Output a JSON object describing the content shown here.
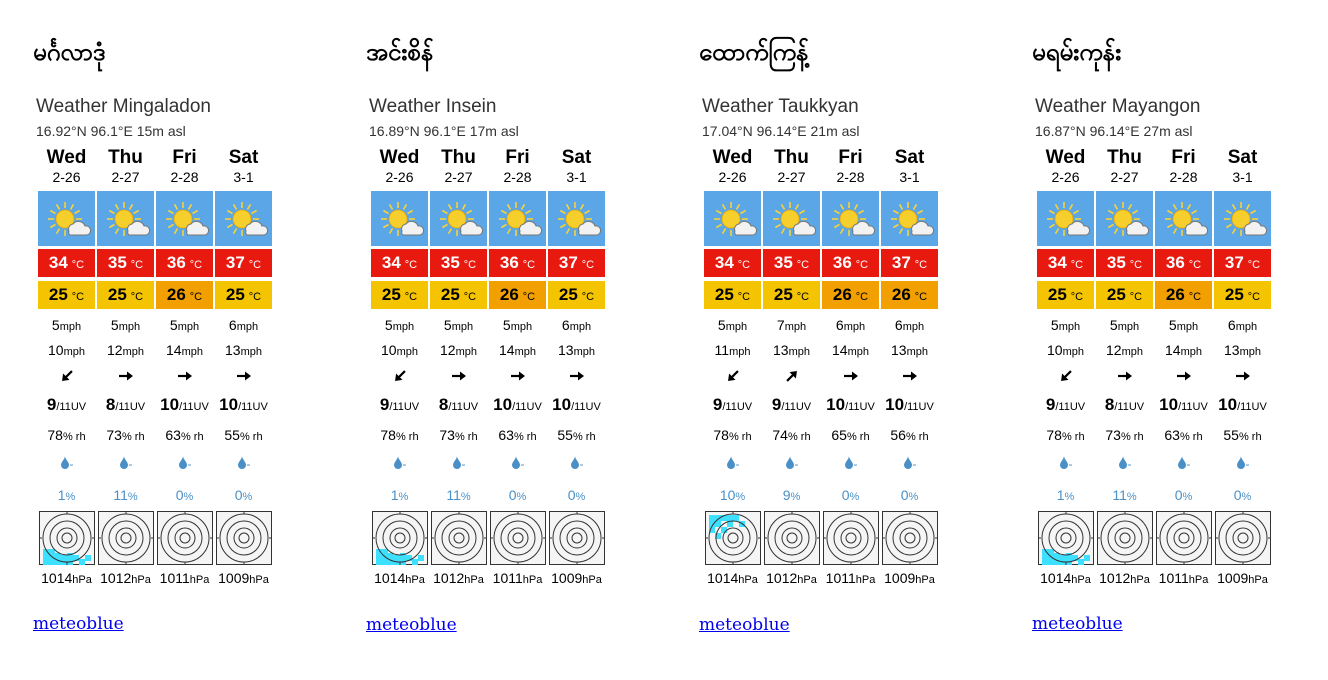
{
  "units": {
    "temp": "°C",
    "wind": "mph",
    "uv": "/11UV",
    "rh": "% rh",
    "precip_dash": "-",
    "percent": "%",
    "pressure": "hPa"
  },
  "link_label": "meteoblue",
  "colors": {
    "sky": "#5aa6e6",
    "max_temp_bg": "#e8190f",
    "min_temp_yellow": "#f5c400",
    "min_temp_orange": "#f2a000",
    "precip": "#4a90c6"
  },
  "panels": [
    {
      "burmese": "မင်္ဂလာဒုံ",
      "title": "Weather Mingaladon",
      "coords": "16.92°N 96.1°E 15m asl",
      "days": [
        {
          "day": "Wed",
          "date": "2-26",
          "max": "34",
          "min": "25",
          "min_color": "yellow",
          "wind": "5",
          "gust": "10",
          "dir": "sw",
          "uv": "9",
          "rh": "78",
          "prob": "1",
          "radar": "sw",
          "pressure": "1014"
        },
        {
          "day": "Thu",
          "date": "2-27",
          "max": "35",
          "min": "25",
          "min_color": "yellow",
          "wind": "5",
          "gust": "12",
          "dir": "e",
          "uv": "8",
          "rh": "73",
          "prob": "11",
          "radar": "none",
          "pressure": "1012"
        },
        {
          "day": "Fri",
          "date": "2-28",
          "max": "36",
          "min": "26",
          "min_color": "orange",
          "wind": "5",
          "gust": "14",
          "dir": "e",
          "uv": "10",
          "rh": "63",
          "prob": "0",
          "radar": "none",
          "pressure": "1011"
        },
        {
          "day": "Sat",
          "date": "3-1",
          "max": "37",
          "min": "25",
          "min_color": "yellow",
          "wind": "6",
          "gust": "13",
          "dir": "e",
          "uv": "10",
          "rh": "55",
          "prob": "0",
          "radar": "none",
          "pressure": "1009"
        }
      ]
    },
    {
      "burmese": "အင်းစိန်",
      "title": "Weather Insein",
      "coords": "16.89°N 96.1°E 17m asl",
      "days": [
        {
          "day": "Wed",
          "date": "2-26",
          "max": "34",
          "min": "25",
          "min_color": "yellow",
          "wind": "5",
          "gust": "10",
          "dir": "sw",
          "uv": "9",
          "rh": "78",
          "prob": "1",
          "radar": "sw",
          "pressure": "1014"
        },
        {
          "day": "Thu",
          "date": "2-27",
          "max": "35",
          "min": "25",
          "min_color": "yellow",
          "wind": "5",
          "gust": "12",
          "dir": "e",
          "uv": "8",
          "rh": "73",
          "prob": "11",
          "radar": "none",
          "pressure": "1012"
        },
        {
          "day": "Fri",
          "date": "2-28",
          "max": "36",
          "min": "26",
          "min_color": "orange",
          "wind": "5",
          "gust": "14",
          "dir": "e",
          "uv": "10",
          "rh": "63",
          "prob": "0",
          "radar": "none",
          "pressure": "1011"
        },
        {
          "day": "Sat",
          "date": "3-1",
          "max": "37",
          "min": "25",
          "min_color": "yellow",
          "wind": "6",
          "gust": "13",
          "dir": "e",
          "uv": "10",
          "rh": "55",
          "prob": "0",
          "radar": "none",
          "pressure": "1009"
        }
      ]
    },
    {
      "burmese": "ထောက်ကြန့်",
      "title": "Weather Taukkyan",
      "coords": "17.04°N 96.14°E 21m asl",
      "days": [
        {
          "day": "Wed",
          "date": "2-26",
          "max": "34",
          "min": "25",
          "min_color": "yellow",
          "wind": "5",
          "gust": "11",
          "dir": "sw",
          "uv": "9",
          "rh": "78",
          "prob": "10",
          "radar": "nw",
          "pressure": "1014"
        },
        {
          "day": "Thu",
          "date": "2-27",
          "max": "35",
          "min": "25",
          "min_color": "yellow",
          "wind": "7",
          "gust": "13",
          "dir": "ne",
          "uv": "9",
          "rh": "74",
          "prob": "9",
          "radar": "none",
          "pressure": "1012"
        },
        {
          "day": "Fri",
          "date": "2-28",
          "max": "36",
          "min": "26",
          "min_color": "orange",
          "wind": "6",
          "gust": "14",
          "dir": "e",
          "uv": "10",
          "rh": "65",
          "prob": "0",
          "radar": "none",
          "pressure": "1011"
        },
        {
          "day": "Sat",
          "date": "3-1",
          "max": "37",
          "min": "26",
          "min_color": "orange",
          "wind": "6",
          "gust": "13",
          "dir": "e",
          "uv": "10",
          "rh": "56",
          "prob": "0",
          "radar": "none",
          "pressure": "1009"
        }
      ]
    },
    {
      "burmese": "မရမ်းကုန်း",
      "title": "Weather Mayangon",
      "coords": "16.87°N 96.14°E 27m asl",
      "days": [
        {
          "day": "Wed",
          "date": "2-26",
          "max": "34",
          "min": "25",
          "min_color": "yellow",
          "wind": "5",
          "gust": "10",
          "dir": "sw",
          "uv": "9",
          "rh": "78",
          "prob": "1",
          "radar": "sw",
          "pressure": "1014"
        },
        {
          "day": "Thu",
          "date": "2-27",
          "max": "35",
          "min": "25",
          "min_color": "yellow",
          "wind": "5",
          "gust": "12",
          "dir": "e",
          "uv": "8",
          "rh": "73",
          "prob": "11",
          "radar": "none",
          "pressure": "1012"
        },
        {
          "day": "Fri",
          "date": "2-28",
          "max": "36",
          "min": "26",
          "min_color": "orange",
          "wind": "5",
          "gust": "14",
          "dir": "e",
          "uv": "10",
          "rh": "63",
          "prob": "0",
          "radar": "none",
          "pressure": "1011"
        },
        {
          "day": "Sat",
          "date": "3-1",
          "max": "37",
          "min": "25",
          "min_color": "yellow",
          "wind": "6",
          "gust": "13",
          "dir": "e",
          "uv": "10",
          "rh": "55",
          "prob": "0",
          "radar": "none",
          "pressure": "1009"
        }
      ]
    }
  ]
}
